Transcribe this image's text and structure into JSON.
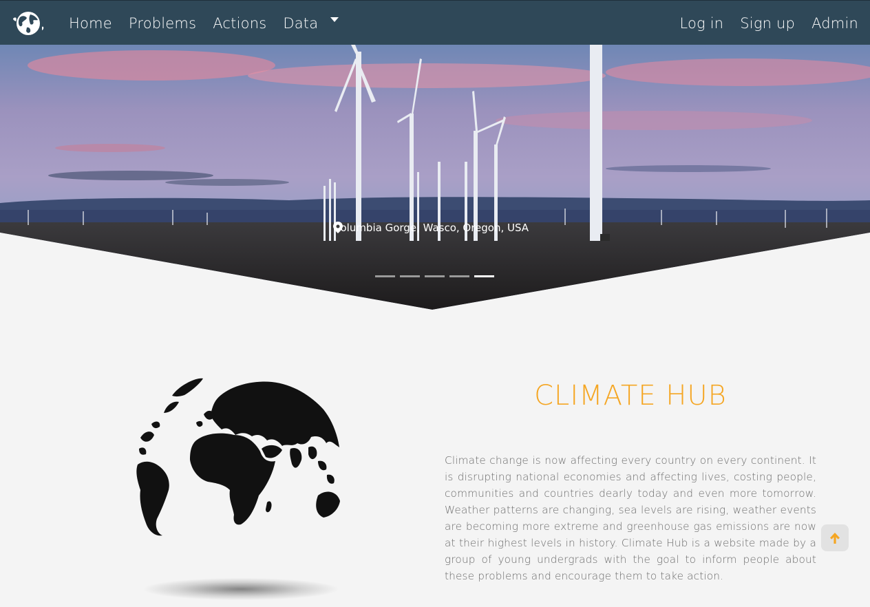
{
  "nav": {
    "logo_icon": "globe-logo-icon",
    "left_items": [
      "Home",
      "Problems",
      "Actions",
      "Data"
    ],
    "right_items": [
      "Log in",
      "Sign up",
      "Admin"
    ],
    "dropdown_icon": "caret-down-icon",
    "background": "#2f4858"
  },
  "hero": {
    "caption": "Columbia Gorge, Wasco, Oregon, USA",
    "caption_icon": "map-pin-icon",
    "slide_count": 5,
    "active_slide": 5
  },
  "about": {
    "title": "CLIMATE HUB",
    "title_color": "#f5a623",
    "description": "Climate change is now affecting every country on every continent. It is disrupting national economies and affecting lives, costing people, communities and countries dearly today and even more tomorrow. Weather patterns are changing, sea levels are rising, weather events are becoming more extreme and greenhouse gas emissions are now at their highest levels in history. Climate Hub is a website made by a group of young undergrads with the goal to inform people about these problems and encourage them to take action.",
    "image_icon": "globe-illustration-icon"
  },
  "scroll_top": {
    "icon": "arrow-up-icon",
    "color": "#f5a623"
  }
}
